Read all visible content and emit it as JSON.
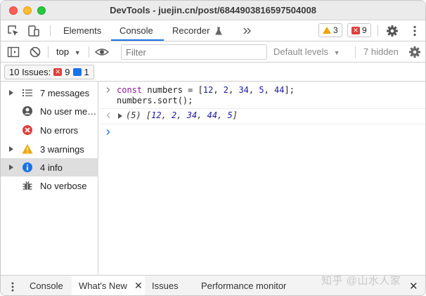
{
  "window": {
    "title": "DevTools - juejin.cn/post/6844903816597504008"
  },
  "tabbar": {
    "tabs": [
      {
        "label": "Elements"
      },
      {
        "label": "Console"
      },
      {
        "label": "Recorder"
      }
    ],
    "active_tab": "Console",
    "more_icon": "double-chevron-right-icon",
    "warning_count": "3",
    "error_count": "9"
  },
  "toolbar": {
    "context": "top",
    "filter_placeholder": "Filter",
    "levels": "Default levels",
    "hidden": "7 hidden"
  },
  "issues": {
    "label": "10 Issues:",
    "error_count": "9",
    "info_count": "1"
  },
  "sidebar": {
    "items": [
      {
        "label": "7 messages",
        "icon": "list-icon",
        "expandable": true
      },
      {
        "label": "No user messages",
        "icon": "user-icon",
        "expandable": false
      },
      {
        "label": "No errors",
        "icon": "error-icon",
        "expandable": false
      },
      {
        "label": "3 warnings",
        "icon": "warning-icon",
        "expandable": true
      },
      {
        "label": "4 info",
        "icon": "info-icon",
        "expandable": true,
        "selected": true
      },
      {
        "label": "No verbose",
        "icon": "bug-icon",
        "expandable": false
      }
    ]
  },
  "console": {
    "input_line1": {
      "kw": "const",
      "name": "numbers",
      "eq": "=",
      "values": [
        "12",
        "2",
        "34",
        "5",
        "44"
      ]
    },
    "input_line2": "numbers.sort();",
    "result_prefix": "(5)",
    "result_values": [
      "12",
      "2",
      "34",
      "44",
      "5"
    ]
  },
  "drawer": {
    "tabs": [
      {
        "label": "Console"
      },
      {
        "label": "What's New"
      },
      {
        "label": "Issues"
      },
      {
        "label": "Performance monitor"
      }
    ],
    "active_tab": "What's New"
  },
  "watermark": "知乎 @山水人家",
  "colors": {
    "accent": "#1a73e8",
    "error": "#e03e3e",
    "warning": "#f0a30a",
    "keyword": "#8b1a9c",
    "number": "#1a1aa6"
  }
}
